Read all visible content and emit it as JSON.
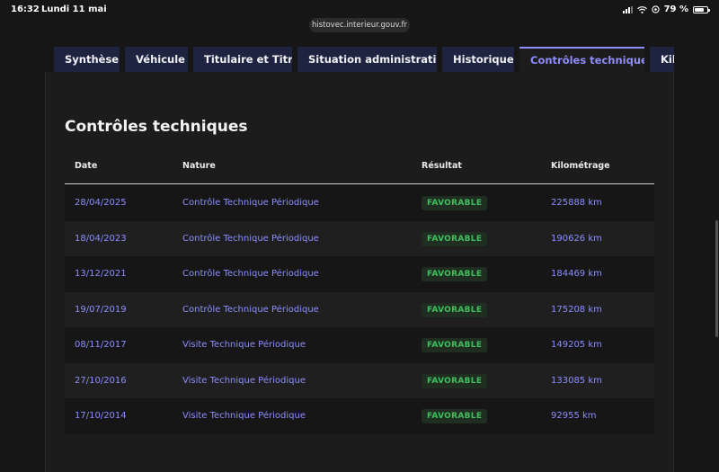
{
  "status_bar": {
    "time": "16:32",
    "date": "Lundi 11 mai",
    "battery": "79 %"
  },
  "browser": {
    "url": "histovec.interieur.gouv.fr"
  },
  "tabs": [
    {
      "label": "Synthèse",
      "active": false
    },
    {
      "label": "Véhicule",
      "active": false
    },
    {
      "label": "Titulaire et Titre",
      "active": false
    },
    {
      "label": "Situation administrative",
      "active": false
    },
    {
      "label": "Historique",
      "active": false
    },
    {
      "label": "Contrôles techniques",
      "active": true
    },
    {
      "label": "Kilo",
      "active": false
    }
  ],
  "main": {
    "title": "Contrôles techniques",
    "columns": [
      "Date",
      "Nature",
      "Résultat",
      "Kilométrage"
    ],
    "rows": [
      {
        "date": "28/04/2025",
        "nature": "Contrôle Technique Périodique",
        "result": "FAVORABLE",
        "km": "225888 km"
      },
      {
        "date": "18/04/2023",
        "nature": "Contrôle Technique Périodique",
        "result": "FAVORABLE",
        "km": "190626 km"
      },
      {
        "date": "13/12/2021",
        "nature": "Contrôle Technique Périodique",
        "result": "FAVORABLE",
        "km": "184469 km"
      },
      {
        "date": "19/07/2019",
        "nature": "Contrôle Technique Périodique",
        "result": "FAVORABLE",
        "km": "175208 km"
      },
      {
        "date": "08/11/2017",
        "nature": "Visite Technique Périodique",
        "result": "FAVORABLE",
        "km": "149205 km"
      },
      {
        "date": "27/10/2016",
        "nature": "Visite Technique Périodique",
        "result": "FAVORABLE",
        "km": "133085 km"
      },
      {
        "date": "17/10/2014",
        "nature": "Visite Technique Périodique",
        "result": "FAVORABLE",
        "km": "92955 km"
      }
    ]
  },
  "colors": {
    "accent": "#8d8dff",
    "tab_bg": "#1e2340",
    "success": "#3fbf5f"
  }
}
